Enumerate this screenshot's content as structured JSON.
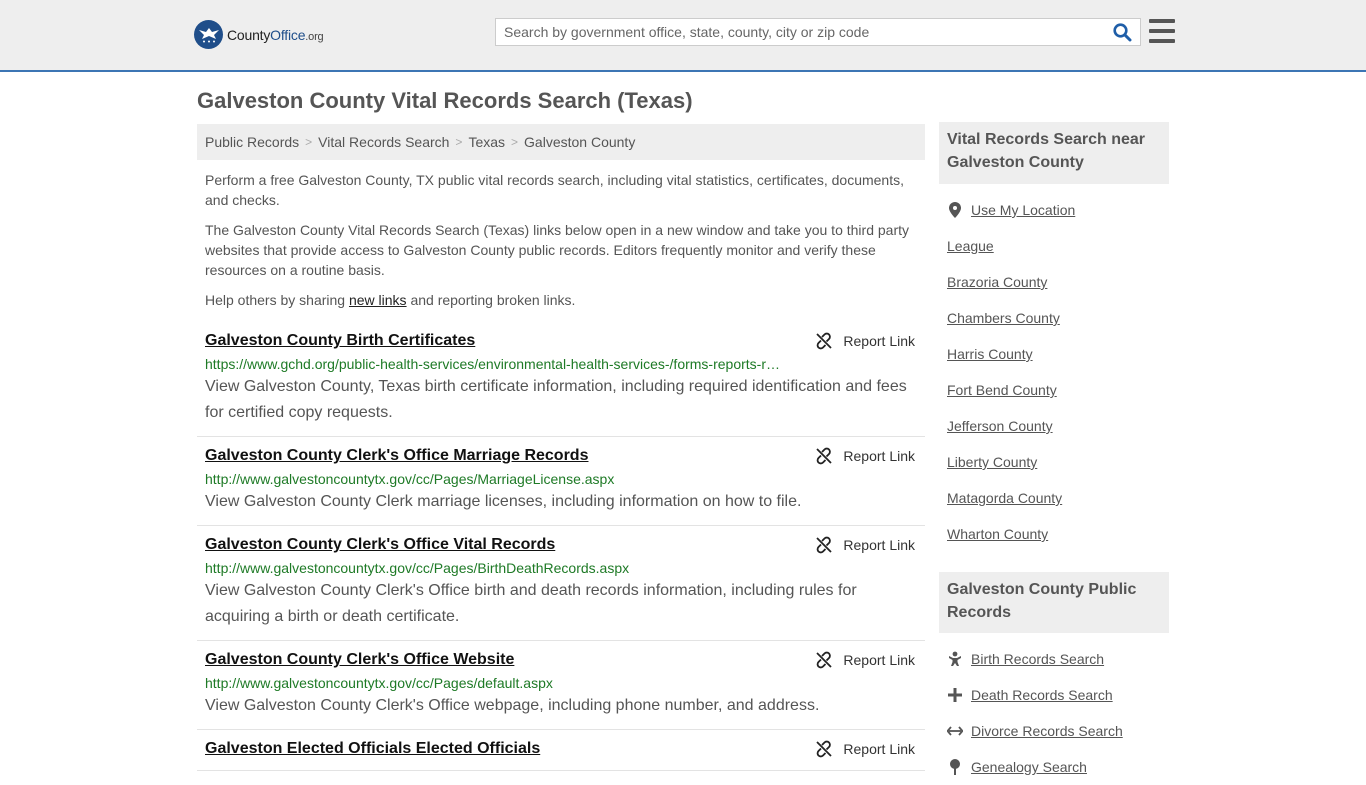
{
  "header": {
    "logo_brand_1": "County",
    "logo_brand_2": "Office",
    "logo_tld": ".org",
    "search_placeholder": "Search by government office, state, county, city or zip code"
  },
  "page_title": "Galveston County Vital Records Search (Texas)",
  "breadcrumb": [
    "Public Records",
    "Vital Records Search",
    "Texas",
    "Galveston County"
  ],
  "intro": {
    "p1": "Perform a free Galveston County, TX public vital records search, including vital statistics, certificates, documents, and checks.",
    "p2": "The Galveston County Vital Records Search (Texas) links below open in a new window and take you to third party websites that provide access to Galveston County public records. Editors frequently monitor and verify these resources on a routine basis.",
    "p3_before": "Help others by sharing ",
    "p3_link": "new links",
    "p3_after": " and reporting broken links."
  },
  "report_label": "Report Link",
  "results": [
    {
      "title": "Galveston County Birth Certificates",
      "url": "https://www.gchd.org/public-health-services/environmental-health-services-/forms-reports-r…",
      "desc": "View Galveston County, Texas birth certificate information, including required identification and fees for certified copy requests."
    },
    {
      "title": "Galveston County Clerk's Office Marriage Records",
      "url": "http://www.galvestoncountytx.gov/cc/Pages/MarriageLicense.aspx",
      "desc": "View Galveston County Clerk marriage licenses, including information on how to file."
    },
    {
      "title": "Galveston County Clerk's Office Vital Records",
      "url": "http://www.galvestoncountytx.gov/cc/Pages/BirthDeathRecords.aspx",
      "desc": "View Galveston County Clerk's Office birth and death records information, including rules for acquiring a birth or death certificate."
    },
    {
      "title": "Galveston County Clerk's Office Website",
      "url": "http://www.galvestoncountytx.gov/cc/Pages/default.aspx",
      "desc": "View Galveston County Clerk's Office webpage, including phone number, and address."
    },
    {
      "title": "Galveston Elected Officials Elected Officials",
      "url": "",
      "desc": ""
    }
  ],
  "sidebar": {
    "nearby_title": "Vital Records Search near Galveston County",
    "nearby": [
      "Use My Location",
      "League",
      "Brazoria County",
      "Chambers County",
      "Harris County",
      "Fort Bend County",
      "Jefferson County",
      "Liberty County",
      "Matagorda County",
      "Wharton County"
    ],
    "public_title": "Galveston County Public Records",
    "public": [
      {
        "label": "Birth Records Search",
        "icon": "baby-icon"
      },
      {
        "label": "Death Records Search",
        "icon": "cross-icon"
      },
      {
        "label": "Divorce Records Search",
        "icon": "split-arrows-icon"
      },
      {
        "label": "Genealogy Search",
        "icon": "tree-icon"
      }
    ]
  },
  "colors": {
    "accent": "#3c75b4",
    "url_green": "#1e7a26",
    "logo_blue": "#1f4e8a"
  }
}
